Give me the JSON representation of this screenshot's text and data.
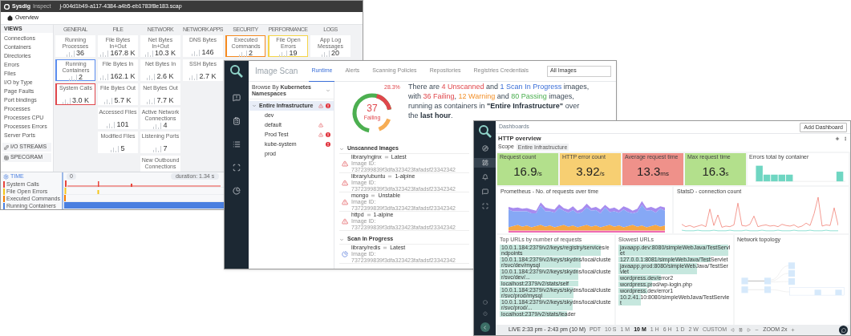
{
  "inspect_window": {
    "logo_text": "Sysdig",
    "product": "Inspect",
    "file": "j-004d1b49-a117-4384-a4b5-eb1783f8e183.scap",
    "breadcrumb": "Overview",
    "sidebar": {
      "heading": "VIEWS",
      "items": [
        "Connections",
        "Containers",
        "Directories",
        "Errors",
        "Files",
        "I/O by Type",
        "Page Faults",
        "Port bindings",
        "Processes",
        "Processes CPU",
        "Processes Errors",
        "Server Ports"
      ],
      "buttons": [
        "I/O STREAMS",
        "SPECGRAM"
      ]
    },
    "columns": [
      {
        "heading": "GENERAL",
        "tiles": [
          {
            "label": "Running Processes",
            "value": "36"
          },
          {
            "label": "Running Containers",
            "value": "2",
            "color": "#5b8def"
          },
          {
            "label": "System Calls",
            "value": "3.0 K",
            "color": "#e0474c"
          }
        ]
      },
      {
        "heading": "FILE",
        "tiles": [
          {
            "label": "File Bytes In+Out",
            "value": "167.8 K"
          },
          {
            "label": "File Bytes In",
            "value": "162.1 K"
          },
          {
            "label": "File Bytes Out",
            "value": "5.7 K"
          },
          {
            "label": "Accessed Files",
            "value": "101"
          },
          {
            "label": "Modified Files",
            "value": "5"
          }
        ]
      },
      {
        "heading": "NETWORK",
        "tiles": [
          {
            "label": "Net Bytes In+Out",
            "value": "10.3 K"
          },
          {
            "label": "Net Bytes In",
            "value": "2.6 K"
          },
          {
            "label": "Net Bytes Out",
            "value": "7.7 K"
          },
          {
            "label": "Active Network Connections",
            "value": "4"
          },
          {
            "label": "Listening Ports",
            "value": "7"
          },
          {
            "label": "New Outbound Connections"
          }
        ]
      },
      {
        "heading": "NETWORK APPS",
        "tiles": [
          {
            "label": "DNS Bytes",
            "value": "146"
          },
          {
            "label": "SSH Bytes",
            "value": "2.7 K"
          }
        ]
      },
      {
        "heading": "SECURITY",
        "tiles": [
          {
            "label": "Executed Commands",
            "value": "2",
            "color": "#f58a1f"
          }
        ]
      },
      {
        "heading": "PERFORMANCE",
        "tiles": [
          {
            "label": "File Open Errors",
            "value": "19",
            "color": "#f5d547"
          }
        ]
      },
      {
        "heading": "LOGS",
        "tiles": [
          {
            "label": "App Log Messages",
            "value": "20"
          }
        ]
      }
    ],
    "timeline": {
      "heading": "TIME",
      "start": "0",
      "duration": "duration: 1.34 s",
      "tracks": [
        {
          "name": "System Calls",
          "color": "#e8453c",
          "kind": "spikes"
        },
        {
          "name": "File Open Errors",
          "color": "#f5c518",
          "kind": "marks"
        },
        {
          "name": "Executed Commands",
          "color": "#f57c00",
          "kind": "marks"
        },
        {
          "name": "Running Containers",
          "color": "#4a7fe0",
          "kind": "band"
        }
      ]
    }
  },
  "scan_window": {
    "title": "Image Scan",
    "tabs": [
      {
        "label": "Runtime",
        "selected": true
      },
      {
        "label": "Alerts",
        "selected": false
      },
      {
        "label": "Scanning Policies",
        "selected": false
      },
      {
        "label": "Repositories",
        "selected": false
      },
      {
        "label": "Registries Credentials",
        "selected": false
      }
    ],
    "filter": "All Images",
    "browse": {
      "prefix": "Browse By",
      "value": "Kubernetes Namespaces"
    },
    "tree": [
      {
        "name": "Entire Infrastructure",
        "expanded": true,
        "selected": true,
        "warning": true,
        "error": true,
        "children": [
          {
            "name": "dev",
            "selected": false,
            "warning": false,
            "error": false
          },
          {
            "name": "default",
            "selected": false,
            "warning": true,
            "error": false
          },
          {
            "name": "Prod Test",
            "selected": false,
            "warning": true,
            "error": true
          },
          {
            "name": "kube-system",
            "selected": false,
            "warning": false,
            "error": true
          },
          {
            "name": "prod",
            "selected": false,
            "warning": false,
            "error": false
          }
        ]
      }
    ],
    "summary": {
      "count": "37",
      "label": "Failing",
      "percent": "28.3%",
      "sentence_lines": [
        [
          {
            "text": "There are ",
            "kind": "plain"
          },
          {
            "text": "4 Unscanned",
            "kind": "red"
          },
          {
            "text": " and ",
            "kind": "plain"
          },
          {
            "text": "1 Scan In Progress",
            "kind": "blue"
          },
          {
            "text": " images,",
            "kind": "plain"
          }
        ],
        [
          {
            "text": "with ",
            "kind": "plain"
          },
          {
            "text": "36 Failing",
            "kind": "red"
          },
          {
            "text": ", ",
            "kind": "plain"
          },
          {
            "text": "12 Warning",
            "kind": "orange"
          },
          {
            "text": " and ",
            "kind": "plain"
          },
          {
            "text": "80 Passing",
            "kind": "green"
          },
          {
            "text": " images,",
            "kind": "plain"
          }
        ],
        [
          {
            "text": "running as containers in ",
            "kind": "plain"
          },
          {
            "text": "\"Entire Infrastructure\"",
            "kind": "bold"
          },
          {
            "text": " over",
            "kind": "plain"
          }
        ],
        [
          {
            "text": "the ",
            "kind": "plain"
          },
          {
            "text": "last hour",
            "kind": "bold"
          },
          {
            "text": ".",
            "kind": "plain"
          }
        ]
      ]
    },
    "sections": [
      {
        "title": "Unscanned Images",
        "expanded": true,
        "images": [
          {
            "kind": "unscanned",
            "name": "library/nginx",
            "tag": "Latest",
            "id_label": "Image ID:",
            "id": "7372399839f3dfa323423fafadsf23342342"
          },
          {
            "kind": "unscanned",
            "name": "library/ubuntu",
            "tag": "1-alpine",
            "id_label": "Image ID:",
            "id": "7372399839f3dfa323423fafadsf23342342"
          },
          {
            "kind": "unscanned",
            "name": "mongo",
            "tag": "Unstable",
            "id_label": "Image ID:",
            "id": "7372399839f3dfa323423fafadsf23342342"
          },
          {
            "kind": "unscanned",
            "name": "httpd",
            "tag": "1-alpine",
            "id_label": "Image ID:",
            "id": "7372399839f3dfa323423fafadsf23342342"
          }
        ]
      },
      {
        "title": "Scan In Progress",
        "expanded": true,
        "images": [
          {
            "kind": "in_progress",
            "name": "library/redis",
            "tag": "Latest",
            "id_label": "Image ID:",
            "id": "7372399839f3dfa323423fafadsf23342342"
          }
        ]
      }
    ]
  },
  "dashboard_window": {
    "title": "Dashboards",
    "add_button": "Add Dashboard",
    "panel_title": "HTTP overview",
    "scope_label": "Scope",
    "scope_value": "Entire Infrastructure",
    "metrics": [
      {
        "label": "Request count",
        "value": "16.9",
        "unit": "/s",
        "color": "#b3e08c"
      },
      {
        "label": "HTTP error count",
        "value": "3.92",
        "unit": "/s",
        "color": "#f7cf72"
      },
      {
        "label": "Average request time",
        "value": "13.3",
        "unit": "ms",
        "color": "#ef918a"
      },
      {
        "label": "Max request time",
        "value": "16.3",
        "unit": "s",
        "color": "#b3e08c"
      }
    ],
    "errors_title": "Errors total by container",
    "requests_title": "Prometheus - No. of requests over time",
    "connections_title": "StatsD - connection count",
    "top_urls_title": "Top URLs by number of requests",
    "top_urls": [
      {
        "url": "10.0.1.184:2379/v2/keys/registry/services/endpoints",
        "level": 0.9
      },
      {
        "url": "10.0.1.184:2379/v2/keys/skydns/local/cluster/svc/dev/mysql",
        "level": 0.72
      },
      {
        "url": "10.0.1.184:2379/v2/keys/skydns/local/cluster/svc/dev/...",
        "level": 0.7
      },
      {
        "url": "localhost:2379/v2/stats/self",
        "level": 0.7
      },
      {
        "url": "10.0.1.184:2379/v2/keys/skydns/local/cluster/svc/prod/mysql",
        "level": 0.66
      },
      {
        "url": "10.0.1.184:2379/v2/keys/skydns/local/cluster/svc/prod/...",
        "level": 0.65
      },
      {
        "url": "localhost:2379/v2/stats/leader",
        "level": 0.6
      }
    ],
    "slowest_title": "Slowest URLs",
    "slowest_urls": [
      {
        "url": "javaapp.dev:8080/simpleWebJava/TestServlet",
        "level": 0.98
      },
      {
        "url": "127.0.0.1:8081/simpleWebJava/TestServlet",
        "level": 0.82
      },
      {
        "url": "javaapp.prod:8080/simpleWebJava/TestServlet",
        "level": 0.7
      },
      {
        "url": "wordpress.dev/error2",
        "level": 0.38
      },
      {
        "url": "wordpress.prod/wp-login.php",
        "level": 0.3
      },
      {
        "url": "wordpress.dev/error1",
        "level": 0.26
      },
      {
        "url": "10.2.41.10:8080/simpleWebJava/TestServlet",
        "level": 0.2
      }
    ],
    "topology_title": "Network topology",
    "time_bar": {
      "live": "LIVE 2:33 pm - 2:43 pm (10 M)",
      "zone": "PDT",
      "ranges": [
        {
          "label": "10 S",
          "selected": false
        },
        {
          "label": "1 M",
          "selected": false
        },
        {
          "label": "10 M",
          "selected": true
        },
        {
          "label": "1 H",
          "selected": false
        },
        {
          "label": "6 H",
          "selected": false
        },
        {
          "label": "1 D",
          "selected": false
        },
        {
          "label": "2 W",
          "selected": false
        },
        {
          "label": "CUSTOM",
          "selected": false
        }
      ],
      "zoom": "ZOOM 2x"
    }
  }
}
